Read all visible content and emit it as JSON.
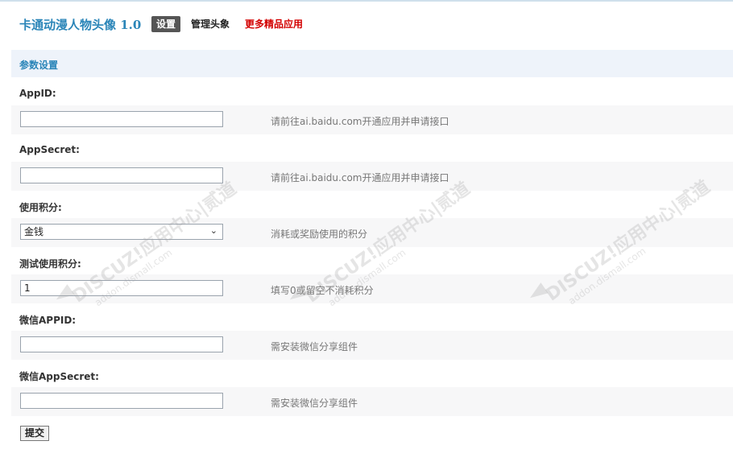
{
  "header": {
    "app_title": "卡通动漫人物头像 1.0",
    "tabs": [
      {
        "label": "设置",
        "active": true
      },
      {
        "label": "管理头象",
        "active": false
      },
      {
        "label": "更多精品应用",
        "active": false
      }
    ]
  },
  "section": {
    "title": "参数设置"
  },
  "fields": [
    {
      "label": "AppID:",
      "value": "",
      "hint": "请前往ai.baidu.com开通应用并申请接口"
    },
    {
      "label": "AppSecret:",
      "value": "",
      "hint": "请前往ai.baidu.com开通应用并申请接口"
    },
    {
      "label": "使用积分:",
      "value": "金钱",
      "hint": "消耗或奖励使用的积分"
    },
    {
      "label": "测试使用积分:",
      "value": "1",
      "hint": "填写0或留空不消耗积分"
    },
    {
      "label": "微信APPID:",
      "value": "",
      "hint": "需安装微信分享组件"
    },
    {
      "label": "微信AppSecret:",
      "value": "",
      "hint": "需安装微信分享组件"
    }
  ],
  "submit_label": "提交",
  "watermark": {
    "brand": "DISCUZ!应用中心|贰道",
    "url": "addon.dismall.com"
  },
  "colors": {
    "accent": "#2a85b8",
    "more_link": "#d30000",
    "section_bg": "#eef3fa"
  }
}
